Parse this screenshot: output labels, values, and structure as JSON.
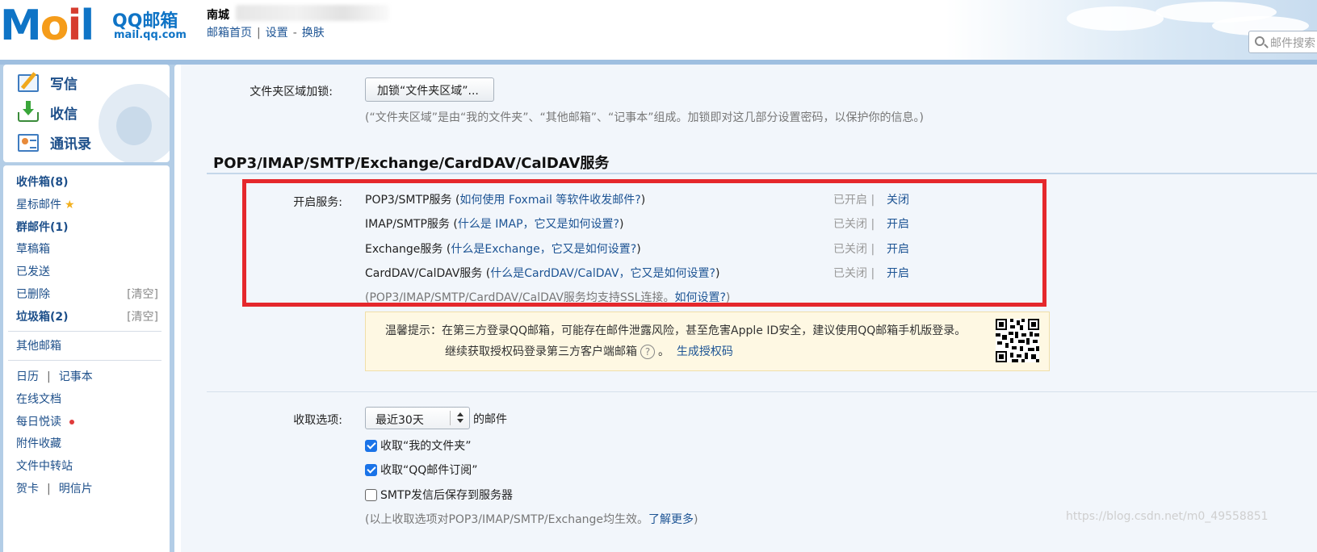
{
  "header": {
    "logo_text": "Mail",
    "logo_brand": "QQ邮箱",
    "logo_domain": "mail.qq.com",
    "user_name": "南城",
    "links": [
      "邮箱首页",
      "设置",
      "换肤"
    ],
    "link_sep": "|",
    "link_dash": "-",
    "search_placeholder": "邮件搜索"
  },
  "sidebar": {
    "actions": {
      "write": "写信",
      "receive": "收信",
      "contacts": "通讯录"
    },
    "folders": {
      "inbox": "收件箱(8)",
      "starred": "星标邮件",
      "group": "群邮件(1)",
      "drafts": "草稿箱",
      "sent": "已发送",
      "deleted": "已删除",
      "spam": "垃圾箱(2)",
      "clear": "[清空]",
      "other_mail": "其他邮箱",
      "calendar": "日历",
      "notes": "记事本",
      "docs": "在线文档",
      "daily_read": "每日悦读",
      "attachments": "附件收藏",
      "transfer": "文件中转站",
      "cards": "贺卡",
      "postcards": "明信片",
      "pipe": "|"
    }
  },
  "main": {
    "folder_lock": {
      "label": "文件夹区域加锁:",
      "button": "加锁“文件夹区域”...",
      "note": "(“文件夹区域”是由“我的文件夹”、“其他邮箱”、“记事本”组成。加锁即对这几部分设置密码，以保护你的信息。)"
    },
    "section_title": "POP3/IMAP/SMTP/Exchange/CardDAV/CalDAV服务",
    "services_label": "开启服务:",
    "services": [
      {
        "name": "POP3/SMTP服务",
        "help": "如何使用 Foxmail 等软件收发邮件?",
        "status": "已开启",
        "action": "关闭"
      },
      {
        "name": "IMAP/SMTP服务",
        "help": "什么是 IMAP，它又是如何设置?",
        "status": "已关闭",
        "action": "开启"
      },
      {
        "name": "Exchange服务",
        "help": "什么是Exchange，它又是如何设置?",
        "status": "已关闭",
        "action": "开启"
      },
      {
        "name": "CardDAV/CalDAV服务",
        "help": "什么是CardDAV/CalDAV，它又是如何设置?",
        "status": "已关闭",
        "action": "开启"
      }
    ],
    "ssl_note": "(POP3/IMAP/SMTP/CardDAV/CalDAV服务均支持SSL连接。",
    "ssl_link": "如何设置?",
    "ssl_close": ")",
    "tip": {
      "line1": "温馨提示：在第三方登录QQ邮箱，可能存在邮件泄露风险，甚至危害Apple ID安全，建议使用QQ邮箱手机版登录。",
      "line2": "继续获取授权码登录第三方客户端邮箱",
      "line2_end": "。",
      "help_glyph": "?",
      "link": "生成授权码"
    },
    "receive": {
      "label": "收取选项:",
      "select_value": "最近30天",
      "suffix": "的邮件",
      "options": [
        {
          "label": "收取“我的文件夹”",
          "checked": true
        },
        {
          "label": "收取“QQ邮件订阅”",
          "checked": true
        },
        {
          "label": "SMTP发信后保存到服务器",
          "checked": false
        }
      ],
      "note": "(以上收取选项对POP3/IMAP/SMTP/Exchange均生效。",
      "note_link": "了解更多",
      "note_close": ")"
    },
    "watermark": "https://blog.csdn.net/m0_49558851"
  },
  "colors": {
    "highlight_border": "#e5282c",
    "link": "#1d5494",
    "frame": "#b3cde6",
    "tip_bg": "#fef8e3"
  }
}
